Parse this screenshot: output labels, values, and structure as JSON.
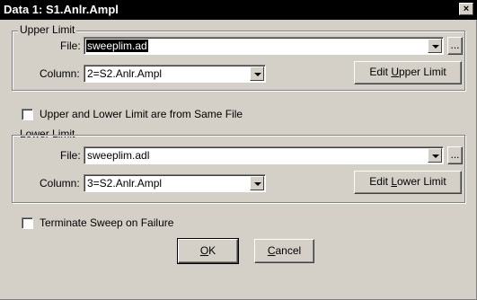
{
  "window": {
    "title": "Data 1: S1.Anlr.Ampl",
    "close_glyph": "×"
  },
  "upper": {
    "legend": "Upper Limit",
    "file_label": "File:",
    "file_value": "sweeplim.ad",
    "browse_label": "...",
    "column_label": "Column:",
    "column_value": "2=S2.Anlr.Ampl",
    "edit_prefix": "Edit ",
    "edit_accel": "U",
    "edit_suffix": "pper Limit"
  },
  "same_file": {
    "label": "Upper and Lower Limit are from Same File",
    "checked": false
  },
  "lower": {
    "legend": "Lower Limit",
    "file_label": "File:",
    "file_value": "sweeplim.adl",
    "browse_label": "...",
    "column_label": "Column:",
    "column_value": "3=S2.Anlr.Ampl",
    "edit_prefix": "Edit ",
    "edit_accel": "L",
    "edit_suffix": "ower Limit"
  },
  "terminate": {
    "label": "Terminate Sweep on Failure",
    "checked": false
  },
  "buttons": {
    "ok_accel": "O",
    "ok_rest": "K",
    "cancel_accel": "C",
    "cancel_rest": "ancel"
  }
}
